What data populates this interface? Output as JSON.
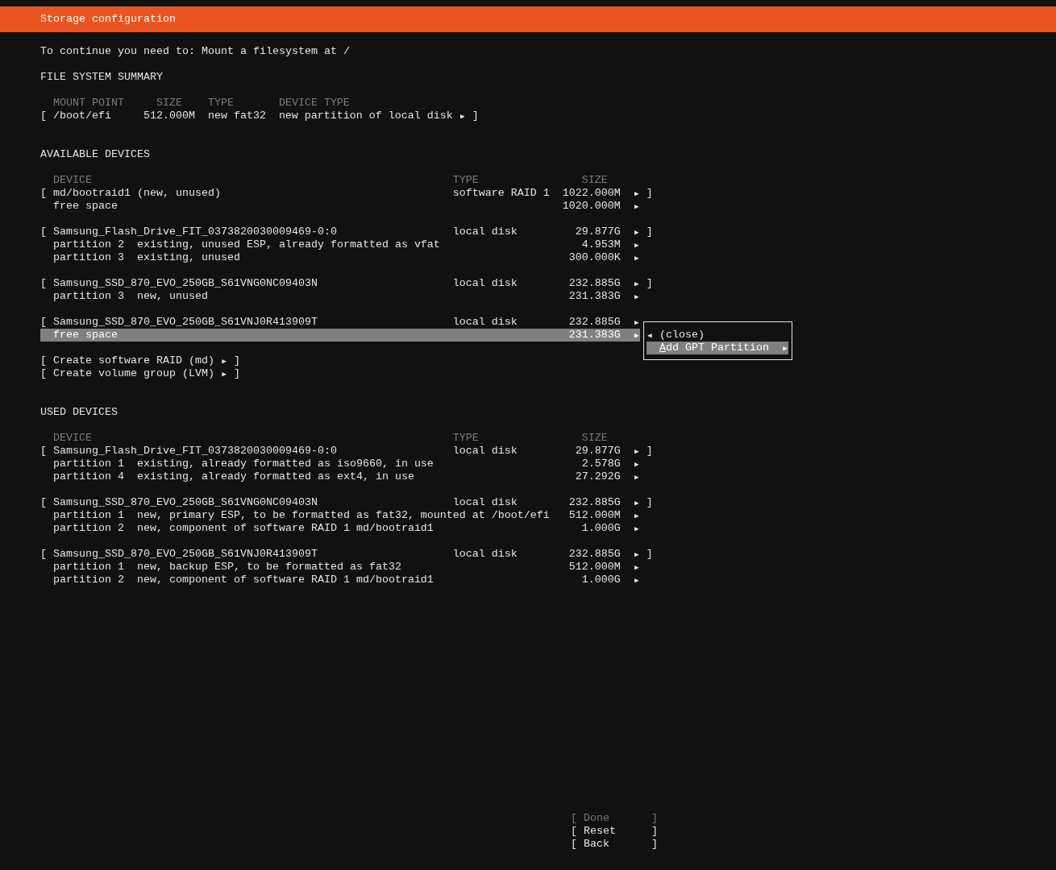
{
  "header": {
    "title": "Storage configuration"
  },
  "message": "To continue you need to: Mount a filesystem at /",
  "filesystem_summary": {
    "heading": "FILE SYSTEM SUMMARY",
    "columns": [
      "MOUNT POINT",
      "SIZE",
      "TYPE",
      "DEVICE TYPE"
    ],
    "rows": [
      {
        "open": "[",
        "mount_point": "/boot/efi",
        "size": "512.000M",
        "type": "new fat32",
        "device_type": "new partition of local disk",
        "arrow": "▶",
        "close": "]"
      }
    ]
  },
  "available_devices": {
    "heading": "AVAILABLE DEVICES",
    "columns": [
      "DEVICE",
      "TYPE",
      "SIZE"
    ],
    "groups": [
      {
        "rows": [
          {
            "kind": "device",
            "selected": false,
            "open": "[",
            "name": "md/bootraid1 (new, unused)",
            "type": "software RAID 1",
            "size": "1022.000M",
            "arrow": "▶",
            "close": "]"
          },
          {
            "kind": "free",
            "selected": false,
            "name": "free space",
            "size": "1020.000M",
            "arrow": "▶"
          }
        ]
      },
      {
        "rows": [
          {
            "kind": "device",
            "selected": false,
            "open": "[",
            "name": "Samsung_Flash_Drive_FIT_0373820030009469-0:0",
            "type": "local disk",
            "size": "29.877G",
            "arrow": "▶",
            "close": "]"
          },
          {
            "kind": "partition",
            "selected": false,
            "name": "partition 2",
            "description": "existing, unused ESP, already formatted as vfat",
            "size": "4.953M",
            "arrow": "▶"
          },
          {
            "kind": "partition",
            "selected": false,
            "name": "partition 3",
            "description": "existing, unused",
            "size": "300.000K",
            "arrow": "▶"
          }
        ]
      },
      {
        "rows": [
          {
            "kind": "device",
            "selected": false,
            "open": "[",
            "name": "Samsung_SSD_870_EVO_250GB_S61VNG0NC09403N",
            "type": "local disk",
            "size": "232.885G",
            "arrow": "▶",
            "close": "]"
          },
          {
            "kind": "partition",
            "selected": false,
            "name": "partition 3",
            "description": "new, unused",
            "size": "231.383G",
            "arrow": "▶"
          }
        ]
      },
      {
        "rows": [
          {
            "kind": "device",
            "selected": false,
            "open": "[",
            "name": "Samsung_SSD_870_EVO_250GB_S61VNJ0R413909T",
            "type": "local disk",
            "size": "232.885G",
            "arrow": "▶"
          },
          {
            "kind": "free",
            "selected": true,
            "name": "free space",
            "size": "231.383G",
            "arrow": "▶"
          }
        ],
        "popup_menu": {
          "items": [
            {
              "icon": "◀",
              "label": "(close)",
              "selected": false
            },
            {
              "accel": "A",
              "label": "dd GPT Partition",
              "arrow": "▶",
              "selected": true
            }
          ]
        }
      }
    ],
    "actions": [
      {
        "open": "[",
        "label": "Create software RAID (md)",
        "arrow": "▶",
        "close": "]"
      },
      {
        "open": "[",
        "label": "Create volume group (LVM)",
        "arrow": "▶",
        "close": "]"
      }
    ]
  },
  "used_devices": {
    "heading": "USED DEVICES",
    "columns": [
      "DEVICE",
      "TYPE",
      "SIZE"
    ],
    "groups": [
      {
        "rows": [
          {
            "kind": "device",
            "selected": false,
            "open": "[",
            "name": "Samsung_Flash_Drive_FIT_0373820030009469-0:0",
            "type": "local disk",
            "size": "29.877G",
            "arrow": "▶",
            "close": "]"
          },
          {
            "kind": "partition",
            "selected": false,
            "name": "partition 1",
            "description": "existing, already formatted as iso9660, in use",
            "size": "2.578G",
            "arrow": "▶"
          },
          {
            "kind": "partition",
            "selected": false,
            "name": "partition 4",
            "description": "existing, already formatted as ext4, in use",
            "size": "27.292G",
            "arrow": "▶"
          }
        ]
      },
      {
        "rows": [
          {
            "kind": "device",
            "selected": false,
            "open": "[",
            "name": "Samsung_SSD_870_EVO_250GB_S61VNG0NC09403N",
            "type": "local disk",
            "size": "232.885G",
            "arrow": "▶",
            "close": "]"
          },
          {
            "kind": "partition",
            "selected": false,
            "name": "partition 1",
            "description": "new, primary ESP, to be formatted as fat32, mounted at /boot/efi",
            "size": "512.000M",
            "arrow": "▶"
          },
          {
            "kind": "partition",
            "selected": false,
            "name": "partition 2",
            "description": "new, component of software RAID 1 md/bootraid1",
            "size": "1.000G",
            "arrow": "▶"
          }
        ]
      },
      {
        "rows": [
          {
            "kind": "device",
            "selected": false,
            "open": "[",
            "name": "Samsung_SSD_870_EVO_250GB_S61VNJ0R413909T",
            "type": "local disk",
            "size": "232.885G",
            "arrow": "▶",
            "close": "]"
          },
          {
            "kind": "partition",
            "selected": false,
            "name": "partition 1",
            "description": "new, backup ESP, to be formatted as fat32",
            "size": "512.000M",
            "arrow": "▶"
          },
          {
            "kind": "partition",
            "selected": false,
            "name": "partition 2",
            "description": "new, component of software RAID 1 md/bootraid1",
            "size": "1.000G",
            "arrow": "▶"
          }
        ]
      }
    ]
  },
  "buttons": [
    {
      "open": "[",
      "label": "Done",
      "close": "]",
      "disabled": true
    },
    {
      "open": "[",
      "label": "Reset",
      "close": "]",
      "disabled": false
    },
    {
      "open": "[",
      "label": "Back",
      "close": "]",
      "disabled": false
    }
  ]
}
